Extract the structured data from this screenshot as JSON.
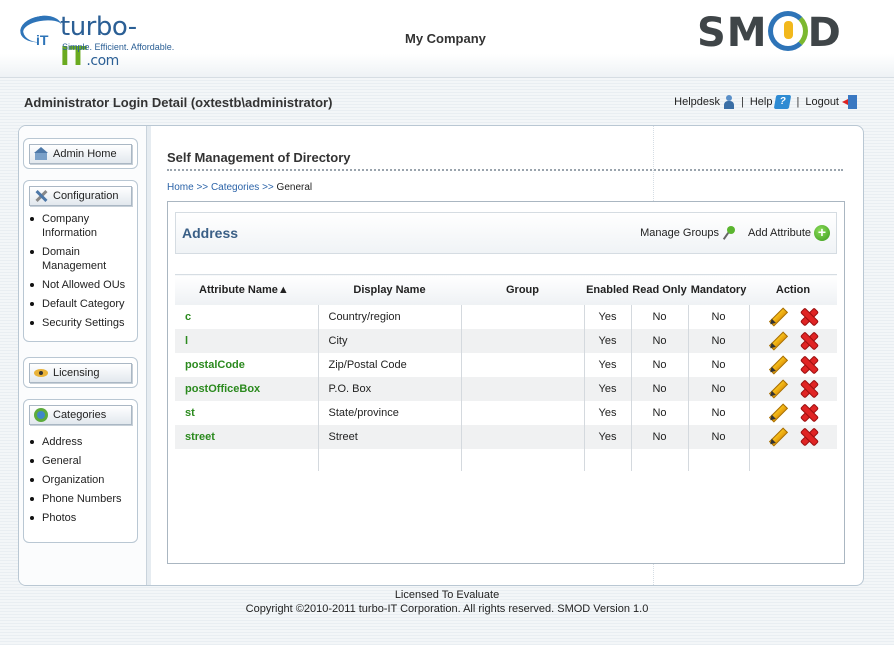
{
  "header": {
    "logo_left": {
      "brand_main": "turbo-",
      "brand_it": "IT",
      "brand_com": ".com",
      "mark": "iT",
      "tagline": "Simple.  Efficient.  Affordable."
    },
    "company": "My Company",
    "logo_right": {
      "s": "SM",
      "d": "D"
    }
  },
  "title_bar": {
    "title": "Administrator Login Detail (oxtestb\\administrator)",
    "links": {
      "helpdesk": "Helpdesk",
      "help": "Help",
      "logout": "Logout",
      "sep": "|"
    }
  },
  "sidebar": {
    "admin_home": "Admin Home",
    "configuration": {
      "label": "Configuration",
      "items": [
        "Company Information",
        "Domain Management",
        "Not Allowed OUs",
        "Default Category",
        "Security Settings"
      ]
    },
    "licensing": "Licensing",
    "categories": {
      "label": "Categories",
      "items": [
        "Address",
        "General",
        "Organization",
        "Phone Numbers",
        "Photos"
      ]
    }
  },
  "main": {
    "page_title": "Self Management of Directory",
    "breadcrumb": {
      "home": "Home",
      "sep": ">>",
      "categories": "Categories",
      "current": "General"
    },
    "panel": {
      "title": "Address",
      "manage_groups": "Manage Groups",
      "add_attribute": "Add Attribute"
    },
    "table": {
      "headers": [
        "Attribute Name",
        "Display Name",
        "Group",
        "Enabled",
        "Read Only",
        "Mandatory",
        "Action"
      ],
      "sort_indicator": "▲",
      "rows": [
        {
          "name": "c",
          "display": "Country/region",
          "group": "",
          "enabled": "Yes",
          "readonly": "No",
          "mandatory": "No"
        },
        {
          "name": "l",
          "display": "City",
          "group": "",
          "enabled": "Yes",
          "readonly": "No",
          "mandatory": "No"
        },
        {
          "name": "postalCode",
          "display": "Zip/Postal Code",
          "group": "",
          "enabled": "Yes",
          "readonly": "No",
          "mandatory": "No"
        },
        {
          "name": "postOfficeBox",
          "display": "P.O. Box",
          "group": "",
          "enabled": "Yes",
          "readonly": "No",
          "mandatory": "No"
        },
        {
          "name": "st",
          "display": "State/province",
          "group": "",
          "enabled": "Yes",
          "readonly": "No",
          "mandatory": "No"
        },
        {
          "name": "street",
          "display": "Street",
          "group": "",
          "enabled": "Yes",
          "readonly": "No",
          "mandatory": "No"
        }
      ]
    }
  },
  "footer": {
    "line1": "Licensed To Evaluate",
    "line2": "Copyright ©2010-2011 turbo-IT Corporation. All rights reserved. SMOD Version 1.0"
  },
  "colors": {
    "link": "#2b63a8",
    "attr_name": "#2b8a1e",
    "panel_title": "#3a5f86",
    "delete": "#e02424"
  }
}
